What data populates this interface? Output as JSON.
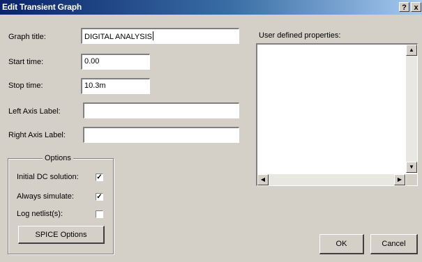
{
  "window": {
    "title": "Edit Transient Graph",
    "help_glyph": "?",
    "close_glyph": "x"
  },
  "fields": {
    "graph_title": {
      "label": "Graph title:",
      "value": "DIGITAL ANALYSIS"
    },
    "start_time": {
      "label": "Start time:",
      "value": "0.00"
    },
    "stop_time": {
      "label": "Stop time:",
      "value": "10.3m"
    },
    "left_axis_label": {
      "label": "Left Axis Label:",
      "value": ""
    },
    "right_axis_label": {
      "label": "Right Axis Label:",
      "value": ""
    }
  },
  "options": {
    "title": "Options",
    "initial_dc": {
      "label": "Initial DC solution:",
      "checked": true
    },
    "always_simulate": {
      "label": "Always simulate:",
      "checked": true
    },
    "log_netlist": {
      "label": "Log netlist(s):",
      "checked": false
    },
    "spice_button": "SPICE Options"
  },
  "user_props": {
    "label": "User defined properties:"
  },
  "buttons": {
    "ok": "OK",
    "cancel": "Cancel"
  },
  "icons": {
    "check": "check-icon",
    "scroll_up": "scroll-up-arrow-icon",
    "scroll_down": "scroll-down-arrow-icon",
    "scroll_left": "scroll-left-arrow-icon",
    "scroll_right": "scroll-right-arrow-icon"
  },
  "colors": {
    "titlebar_start": "#0a246a",
    "titlebar_end": "#a6caf0",
    "face": "#d4d0c8"
  }
}
